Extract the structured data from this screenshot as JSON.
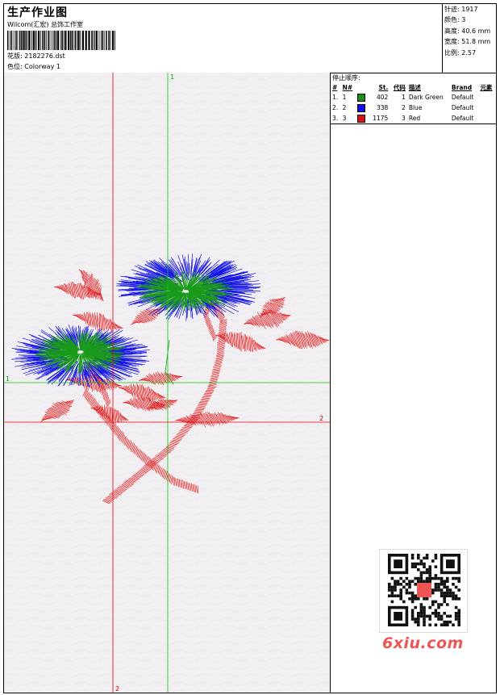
{
  "header": {
    "title": "生产作业图",
    "subtitle": "Wilcom(汇宏) 总饰工作室",
    "design_label": "花版: 2182276.dst",
    "colorway_label": "色位: Colorway 1"
  },
  "stats": {
    "stitches": "针迹: 1917",
    "colors": "颜色: 3",
    "height": "高度: 40.6 mm",
    "width": "宽度: 51.8 mm",
    "scale": "比例: 2.57"
  },
  "stop_sequence": {
    "title": "停止顺序:",
    "headers": [
      "#",
      "N#",
      "St.",
      "代码",
      "描述",
      "Brand",
      "元素"
    ],
    "rows": [
      {
        "idx": "1.",
        "n": "1",
        "color": "#1a8f1a",
        "stitches": "402",
        "code": "1",
        "desc": "Dark Green",
        "brand": "Default",
        "element": ""
      },
      {
        "idx": "2.",
        "n": "2",
        "color": "#1010e0",
        "stitches": "338",
        "code": "2",
        "desc": "Blue",
        "brand": "Default",
        "element": ""
      },
      {
        "idx": "3.",
        "n": "3",
        "color": "#e01010",
        "stitches": "1175",
        "code": "3",
        "desc": "Red",
        "brand": "Default",
        "element": ""
      }
    ]
  },
  "axes": {
    "green_vertical_label": "1",
    "green_horizontal_label": "1",
    "red_horizontal_label": "2",
    "red_vertical_label": "2"
  },
  "colors": {
    "red": "#e01010",
    "green": "#1a9a1a",
    "blue": "#1414e8",
    "guide_red": "#e00000",
    "guide_green": "#00c800"
  },
  "watermark": "6xiu.com"
}
